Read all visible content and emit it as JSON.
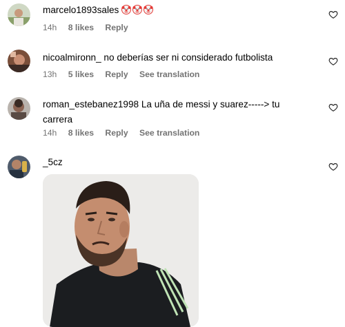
{
  "comments": [
    {
      "username": "marcelo1893sales",
      "text": "",
      "emoji_icons": [
        "clown-face-icon",
        "clown-face-icon",
        "clown-face-icon"
      ],
      "time": "14h",
      "likes": "8 likes",
      "reply": "Reply",
      "translation": ""
    },
    {
      "username": "nicoalmironn_",
      "text": "no deberías ser ni considerado futbolista",
      "time": "13h",
      "likes": "5 likes",
      "reply": "Reply",
      "translation": "See translation"
    },
    {
      "username": "roman_estebanez1998",
      "text": "La uña de messi y suarez-----> tu carrera",
      "time": "14h",
      "likes": "8 likes",
      "reply": "Reply",
      "translation": "See translation"
    },
    {
      "username": "_5cz",
      "text": "",
      "gif": "footballer-frown-gif"
    }
  ],
  "icons": {
    "like": "heart-outline-icon"
  },
  "colors": {
    "meta_text": "#737373",
    "background": "#ffffff"
  }
}
